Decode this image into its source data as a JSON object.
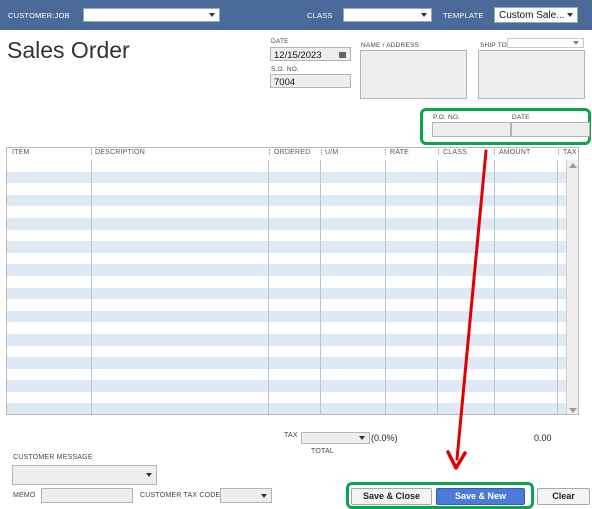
{
  "header": {
    "customer_job_label": "CUSTOMER:JOB",
    "class_label": "CLASS",
    "template_label": "TEMPLATE",
    "template_value": "Custom Sale..."
  },
  "form": {
    "title": "Sales Order",
    "date_label": "DATE",
    "date_value": "12/15/2023",
    "so_no_label": "S.O. NO.",
    "so_no_value": "7004",
    "name_address_label": "NAME / ADDRESS",
    "ship_to_label": "SHIP TO",
    "po_no_label": "P.O. NO.",
    "po_date_label": "DATE"
  },
  "table": {
    "columns": [
      "ITEM",
      "DESCRIPTION",
      "ORDERED",
      "U/M",
      "RATE",
      "CLASS",
      "AMOUNT",
      "TAX"
    ]
  },
  "footer": {
    "tax_label": "TAX",
    "tax_rate": "(0.0%)",
    "tax_amount": "0.00",
    "total_label": "TOTAL",
    "customer_message_label": "CUSTOMER MESSAGE",
    "memo_label": "MEMO",
    "customer_tax_code_label": "CUSTOMER TAX CODE"
  },
  "buttons": {
    "save_close": "Save & Close",
    "save_new": "Save & New",
    "clear": "Clear"
  },
  "colors": {
    "header_bar": "#4a6a99",
    "highlight": "#0da54a",
    "annotation_arrow": "#e00000",
    "row_stripe": "#dfe9f6",
    "primary_button": "#4b7bd6"
  }
}
